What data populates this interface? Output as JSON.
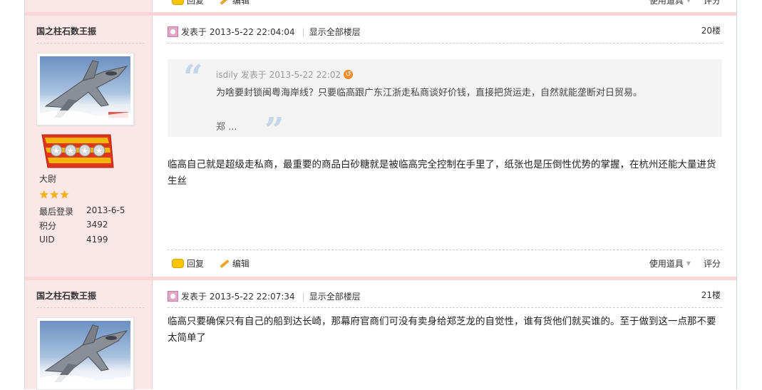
{
  "prev_post": {
    "actions": {
      "reply": "回复",
      "edit": "编辑",
      "tools": "使用道具",
      "rate": "评分"
    }
  },
  "post20": {
    "author": "国之柱石数王振",
    "rank": "大尉",
    "stats": [
      {
        "label": "最后登录",
        "value": "2013-6-5"
      },
      {
        "label": "积分",
        "value": "3492"
      },
      {
        "label": "UID",
        "value": "4199"
      }
    ],
    "posted_label": "发表于",
    "posted_at": "2013-5-22 22:04:04",
    "show_all": "显示全部楼层",
    "floor": "20楼",
    "quote": {
      "user": "isdily",
      "posted_label": "发表于",
      "posted_at": "2013-5-22 22:02",
      "text": "为啥要封锁闽粤海岸线？只要临高跟广东江浙走私商谈好价钱，直接把货运走，自然就能垄断对日贸易。",
      "more": "郑 ..."
    },
    "content": "临高自己就是超级走私商，最重要的商品白砂糖就是被临高完全控制在手里了，纸张也是压倒性优势的掌握，在杭州还能大量进货生丝",
    "actions": {
      "reply": "回复",
      "edit": "编辑",
      "tools": "使用道具",
      "rate": "评分"
    }
  },
  "post21": {
    "author": "国之柱石数王振",
    "posted_label": "发表于",
    "posted_at": "2013-5-22 22:07:34",
    "show_all": "显示全部楼层",
    "floor": "21楼",
    "content": "临高只要确保只有自己的船到达长崎，那幕府官商们可没有卖身给郑芝龙的自觉性，谁有货他们就买谁的。至于做到这一点那不要太简单了"
  },
  "colors": {
    "side_bg": "#fbe7e7",
    "separator": "#fbd6d6",
    "star": "#f6b200",
    "badge": "#e0351c"
  }
}
